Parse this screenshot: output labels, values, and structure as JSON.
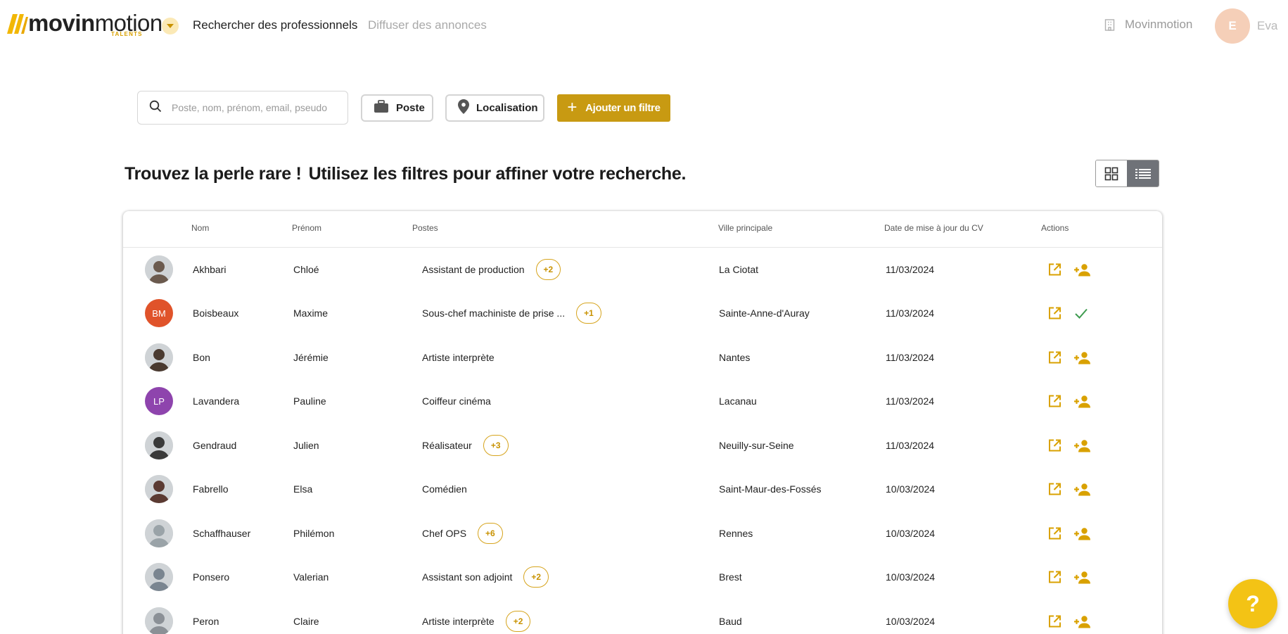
{
  "brand": {
    "name_bold": "movin",
    "name_light": "motion",
    "sub": "TALENTS",
    "accent": "#c89a12"
  },
  "nav": {
    "active": "Rechercher des professionnels",
    "inactive": "Diffuser des annonces"
  },
  "org": {
    "name": "Movinmotion",
    "icon": "building-icon"
  },
  "user": {
    "initial": "E",
    "name": "Eva"
  },
  "filters": {
    "search_placeholder": "Poste, nom, prénom, email, pseudo",
    "poste_label": "Poste",
    "localisation_label": "Localisation",
    "add_filter_label": "Ajouter un filtre"
  },
  "heading": {
    "part1": "Trouvez la perle rare !",
    "part2": "Utilisez les filtres pour affiner votre recherche."
  },
  "table": {
    "headers": {
      "nom": "Nom",
      "prenom": "Prénom",
      "postes": "Postes",
      "ville": "Ville principale",
      "date": "Date de mise à jour du CV",
      "actions": "Actions"
    },
    "rows": [
      {
        "avatar": "photo",
        "initials": "",
        "avatar_color": "#6b5a4e",
        "nom": "Akhbari",
        "prenom": "Chloé",
        "poste": "Assistant de production",
        "extra": "+2",
        "ville": "La Ciotat",
        "date": "11/03/2024",
        "added": false
      },
      {
        "avatar": "initials",
        "initials": "BM",
        "avatar_color": "#e0532a",
        "nom": "Boisbeaux",
        "prenom": "Maxime",
        "poste": "Sous-chef machiniste de prise ...",
        "extra": "+1",
        "ville": "Sainte-Anne-d'Auray",
        "date": "11/03/2024",
        "added": true
      },
      {
        "avatar": "photo",
        "initials": "",
        "avatar_color": "#4a3a30",
        "nom": "Bon",
        "prenom": "Jérémie",
        "poste": "Artiste interprète",
        "extra": "",
        "ville": "Nantes",
        "date": "11/03/2024",
        "added": false
      },
      {
        "avatar": "initials",
        "initials": "LP",
        "avatar_color": "#8e44ad",
        "nom": "Lavandera",
        "prenom": "Pauline",
        "poste": "Coiffeur cinéma",
        "extra": "",
        "ville": "Lacanau",
        "date": "11/03/2024",
        "added": false
      },
      {
        "avatar": "photo",
        "initials": "",
        "avatar_color": "#3a3a3a",
        "nom": "Gendraud",
        "prenom": "Julien",
        "poste": "Réalisateur",
        "extra": "+3",
        "ville": "Neuilly-sur-Seine",
        "date": "11/03/2024",
        "added": false
      },
      {
        "avatar": "photo",
        "initials": "",
        "avatar_color": "#5b3a32",
        "nom": "Fabrello",
        "prenom": "Elsa",
        "poste": "Comédien",
        "extra": "",
        "ville": "Saint-Maur-des-Fossés",
        "date": "10/03/2024",
        "added": false
      },
      {
        "avatar": "photo",
        "initials": "",
        "avatar_color": "#9aa3a8",
        "nom": "Schaffhauser",
        "prenom": "Philémon",
        "poste": "Chef OPS",
        "extra": "+6",
        "ville": "Rennes",
        "date": "10/03/2024",
        "added": false
      },
      {
        "avatar": "photo",
        "initials": "",
        "avatar_color": "#7a8590",
        "nom": "Ponsero",
        "prenom": "Valerian",
        "poste": "Assistant son adjoint",
        "extra": "+2",
        "ville": "Brest",
        "date": "10/03/2024",
        "added": false
      },
      {
        "avatar": "photo",
        "initials": "",
        "avatar_color": "#8b9096",
        "nom": "Peron",
        "prenom": "Claire",
        "poste": "Artiste interprète",
        "extra": "+2",
        "ville": "Baud",
        "date": "10/03/2024",
        "added": false
      }
    ]
  },
  "help": {
    "label": "?"
  }
}
